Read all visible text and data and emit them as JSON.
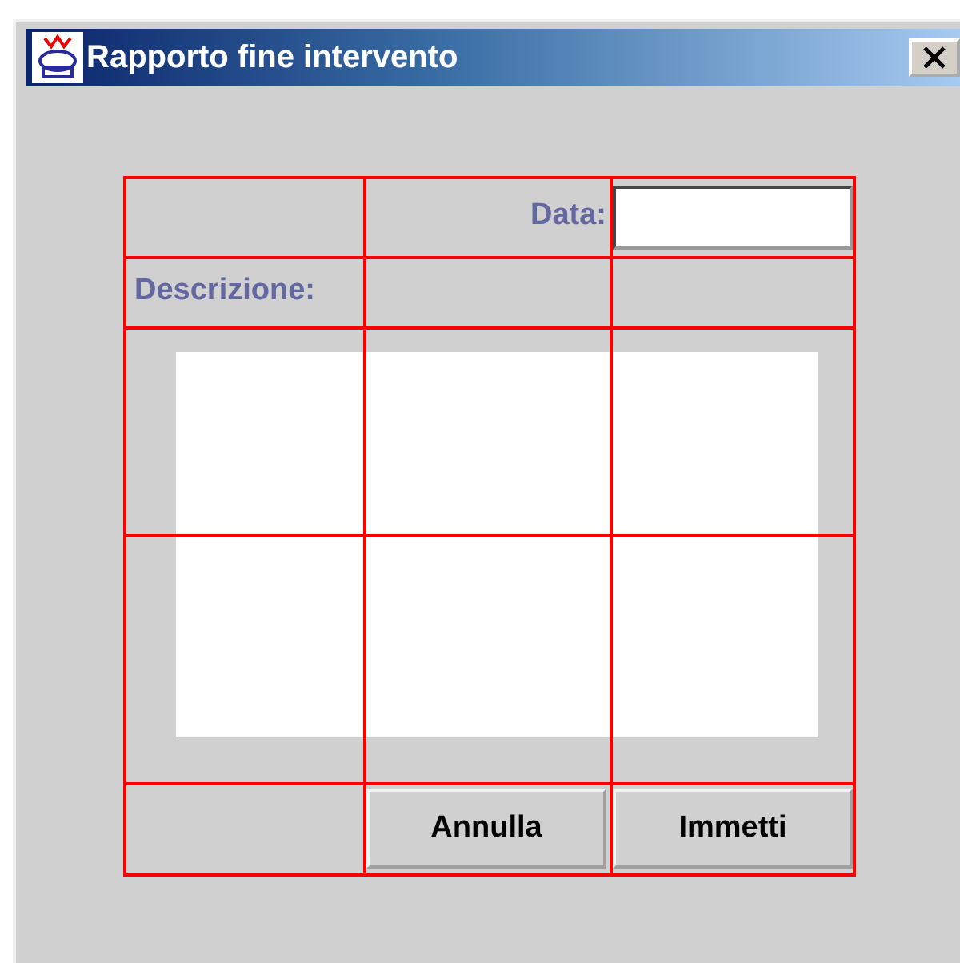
{
  "window": {
    "title": "Rapporto fine intervento"
  },
  "form": {
    "date_label": "Data:",
    "description_label": "Descrizione:"
  },
  "buttons": [
    {
      "label": "Annulla"
    },
    {
      "label": "Immetti"
    }
  ]
}
